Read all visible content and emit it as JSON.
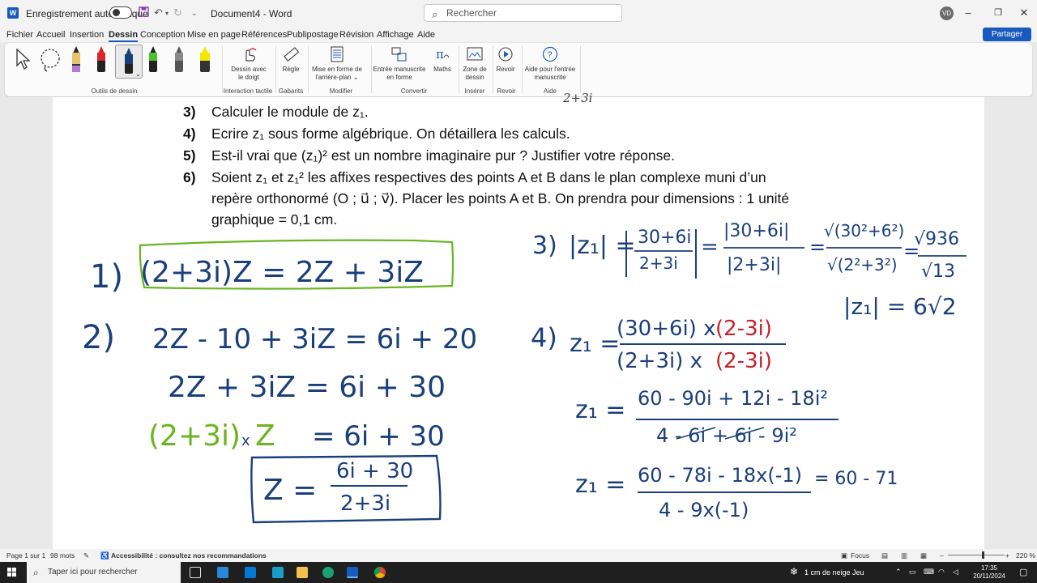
{
  "titlebar": {
    "autosave_label": "Enregistrement automatique",
    "doc_title": "Document4 - Word",
    "search_placeholder": "Rechercher",
    "user_initials": "VD",
    "app_letter": "W"
  },
  "tabs": {
    "items": [
      "Fichier",
      "Accueil",
      "Insertion",
      "Dessin",
      "Conception",
      "Mise en page",
      "Références",
      "Publipostage",
      "Révision",
      "Affichage",
      "Aide"
    ],
    "active": "Dessin",
    "share_label": "Partager"
  },
  "ribbon": {
    "groups": {
      "drawing_tools": "Outils de dessin",
      "touch": "Interaction tactile",
      "stencils": "Gabarits",
      "modify": "Modifier",
      "convert": "Convertir",
      "insert": "Insérer",
      "replay": "Revoir",
      "help": "Aide"
    },
    "buttons": {
      "draw_finger_1": "Dessin avec",
      "draw_finger_2": "le doigt",
      "ruler": "Règle",
      "bg_format_1": "Mise en forme de",
      "bg_format_2": "l'arrière-plan",
      "ink_shape_1": "Entrée manuscrite",
      "ink_shape_2": "en forme",
      "math": "Maths",
      "draw_canvas_1": "Zone de",
      "draw_canvas_2": "dessin",
      "replay": "Revoir",
      "ink_help_1": "Aide pour l'entrée",
      "ink_help_2": "manuscrite"
    }
  },
  "document": {
    "questions": [
      {
        "num": "3)",
        "text": "Calculer le module de z₁."
      },
      {
        "num": "4)",
        "text": "Ecrire z₁ sous forme algébrique. On détaillera les calculs."
      },
      {
        "num": "5)",
        "text": "Est-il vrai que (z₁)² est un nombre imaginaire pur ? Justifier votre réponse."
      },
      {
        "num": "6)",
        "text": "Soient z₁ et z₁²  les affixes respectives des points A et B dans le plan complexe muni d’un"
      },
      {
        "num": "",
        "text": "repère orthonormé (O ; u⃗ ; v⃗).  Placer les points A et B. On prendra pour dimensions : 1 unité"
      },
      {
        "num": "",
        "text": "graphique =  0,1 cm."
      }
    ],
    "top_fragment": "2+3i",
    "handwriting": {
      "a1_label": "1)",
      "a1_eq": "(2+3i)Z = 2Z + 3iZ",
      "a2_label": "2)",
      "a2_line1": "2Z - 10 + 3iZ = 6i + 20",
      "a2_line2": "2Z + 3iZ  = 6i + 30",
      "a2_line3_green": "(2+3i)",
      "a2_line3_rest": "= 6i + 30",
      "a2_x": "x",
      "a2_z": "Z",
      "box_lhs": "Z =",
      "box_num": "6i + 30",
      "box_den": "2+3i",
      "a3_label": "3)",
      "a3_lhs": "|z₁| =",
      "a3_f1_num": "30+6i",
      "a3_f1_den": "2+3i",
      "a3_f2_num": "|30+6i|",
      "a3_f2_den": "|2+3i|",
      "a3_f3_num": "√(30²+6²)",
      "a3_f3_den": "√(2²+3²)",
      "a3_f4_num": "√936",
      "a3_f4_den": "√13",
      "a3_result": "|z₁| = 6√2",
      "a4_label": "4)",
      "a4_lhs": "z₁ =",
      "a4_num_blue": "(30+6i) x",
      "a4_num_red": "(2-3i)",
      "a4_den_blue": "(2+3i) x",
      "a4_den_red": "(2-3i)",
      "a4_l2_lhs": "z₁ =",
      "a4_l2_num": "60 - 90i + 12i - 18i²",
      "a4_l2_den": "4 - 6i + 6i - 9i²",
      "a4_l3_lhs": "z₁ =",
      "a4_l3_num": "60 - 78i - 18x(-1)",
      "a4_l3_den": "4 - 9x(-1)",
      "a4_l3_tail": "= 60 - 71"
    }
  },
  "statusbar": {
    "page": "Page 1 sur 1",
    "words": "98 mots",
    "accessibility": "Accessibilité : consultez nos recommandations",
    "focus": "Focus",
    "zoom": "220 %"
  },
  "taskbar": {
    "search_placeholder": "Taper ici pour rechercher",
    "weather": "1 cm de neige Jeu",
    "time": "17:35",
    "date": "20/11/2024"
  },
  "colors": {
    "ink_blue": "#1b3f7a",
    "ink_green": "#6ab520",
    "ink_red": "#c8202a",
    "word_blue": "#185abd"
  }
}
